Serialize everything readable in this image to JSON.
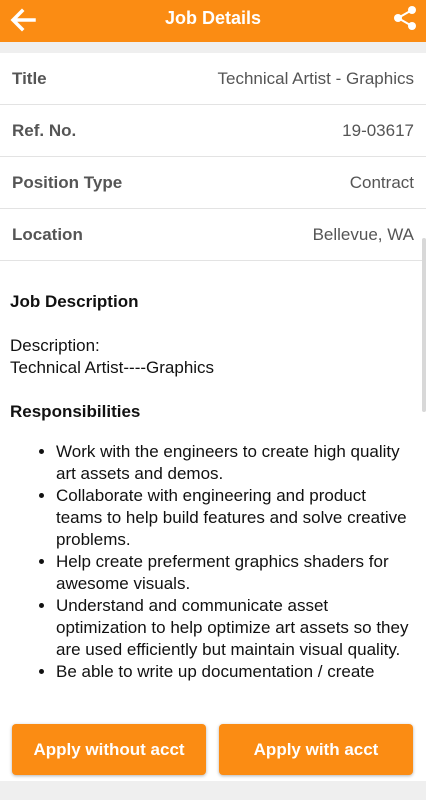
{
  "header": {
    "title": "Job Details",
    "back_icon": "arrow-left-icon",
    "share_icon": "share-icon",
    "accent": "#fb8c13"
  },
  "details": [
    {
      "label": "Title",
      "value": "Technical Artist - Graphics"
    },
    {
      "label": "Ref. No.",
      "value": "19-03617"
    },
    {
      "label": "Position Type",
      "value": "Contract"
    },
    {
      "label": "Location",
      "value": "Bellevue, WA"
    }
  ],
  "description": {
    "heading": "Job Description",
    "line1": "Description:",
    "line2": "Technical Artist----Graphics",
    "responsibilities_heading": "Responsibilities",
    "responsibilities": [
      "Work with the engineers to create high quality art assets and demos.",
      "Collaborate with engineering and product teams to help build features and solve creative problems.",
      "Help create preferment graphics shaders for awesome visuals.",
      "Understand and communicate asset optimization to help optimize art assets so they are used efficiently but maintain visual quality.",
      "Be able to write up documentation / create"
    ]
  },
  "footer": {
    "apply_without": "Apply without acct",
    "apply_with": "Apply with acct"
  }
}
